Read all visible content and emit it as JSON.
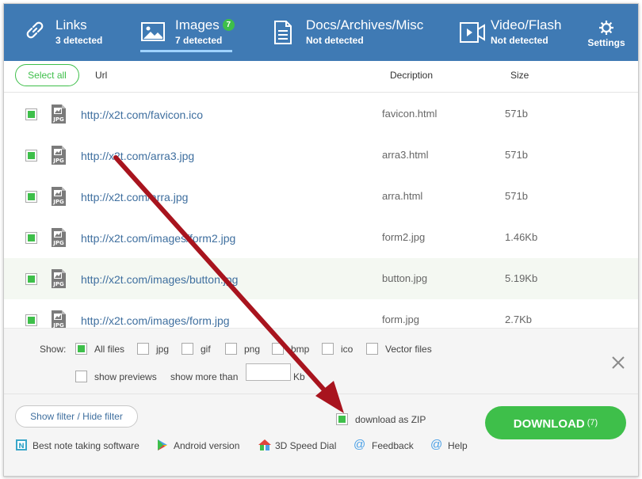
{
  "tabs": [
    {
      "name": "Links",
      "sub": "3 detected",
      "icon": "link-icon"
    },
    {
      "name": "Images",
      "badge": "7",
      "sub": "7 detected",
      "icon": "image-icon",
      "active": true
    },
    {
      "name": "Docs/Archives/Misc",
      "sub": "Not detected",
      "icon": "document-icon"
    },
    {
      "name": "Video/Flash",
      "sub": "Not detected",
      "icon": "video-icon"
    }
  ],
  "settings": {
    "label": "Settings",
    "icon": "gear-icon"
  },
  "table": {
    "select_all": "Select all",
    "columns": {
      "url": "Url",
      "description": "Decription",
      "size": "Size"
    },
    "rows": [
      {
        "url": "http://x2t.com/favicon.ico",
        "description": "favicon.html",
        "size": "571b",
        "checked": true,
        "file_type": "JPG"
      },
      {
        "url": "http://x2t.com/arra3.jpg",
        "description": "arra3.html",
        "size": "571b",
        "checked": true,
        "file_type": "JPG"
      },
      {
        "url": "http://x2t.com/arra.jpg",
        "description": "arra.html",
        "size": "571b",
        "checked": true,
        "file_type": "JPG"
      },
      {
        "url": "http://x2t.com/images/form2.jpg",
        "description": "form2.jpg",
        "size": "1.46Kb",
        "checked": true,
        "file_type": "JPG"
      },
      {
        "url": "http://x2t.com/images/button.jpg",
        "description": "button.jpg",
        "size": "5.19Kb",
        "checked": true,
        "file_type": "JPG"
      },
      {
        "url": "http://x2t.com/images/form.jpg",
        "description": "form.jpg",
        "size": "2.7Kb",
        "checked": true,
        "file_type": "JPG"
      }
    ]
  },
  "filters": {
    "show_label": "Show:",
    "types": [
      {
        "label": "All files",
        "checked": true
      },
      {
        "label": "jpg",
        "checked": false
      },
      {
        "label": "gif",
        "checked": false
      },
      {
        "label": "png",
        "checked": false
      },
      {
        "label": "bmp",
        "checked": false
      },
      {
        "label": "ico",
        "checked": false
      },
      {
        "label": "Vector files",
        "checked": false
      }
    ],
    "show_previews": "show previews",
    "show_more_than": "show more than",
    "size_value": "",
    "size_unit": "Kb"
  },
  "footer": {
    "show_filter": "Show filter / Hide filter",
    "download_zip": "download as ZIP",
    "download_zip_checked": true,
    "download_label": "DOWNLOAD",
    "download_count": "(7)",
    "links": [
      {
        "label": "Best note taking software",
        "icon": "note-icon"
      },
      {
        "label": "Android version",
        "icon": "play-store-icon"
      },
      {
        "label": "3D Speed Dial",
        "icon": "speed-dial-icon"
      },
      {
        "label": "Feedback",
        "icon": "at-icon"
      },
      {
        "label": "Help",
        "icon": "at-icon"
      }
    ]
  },
  "colors": {
    "header": "#3f7ab4",
    "accent": "#3ebf4a",
    "link": "#3f6f9f",
    "arrow": "#a8141e"
  }
}
